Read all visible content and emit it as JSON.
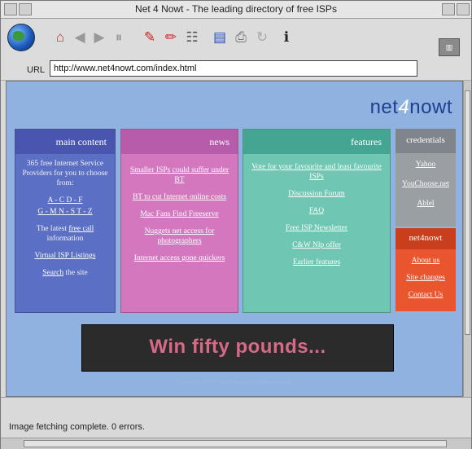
{
  "window": {
    "title": "Net 4 Nowt - The leading directory of free ISPs"
  },
  "toolbar": {
    "url_label": "URL",
    "url_value": "http://www.net4nowt.com/index.html",
    "icons": [
      "globe-icon",
      "home-icon",
      "back-icon",
      "forward-icon",
      "reload-icon",
      "edit-icon",
      "print-icon",
      "save-icon",
      "hotlist-icon",
      "stop-icon",
      "history-icon",
      "info-icon"
    ]
  },
  "site": {
    "logo_pre": "net",
    "logo_mid": "4",
    "logo_post": "nowt",
    "main": {
      "title": "main content",
      "intro": "365 free Internet Service Providers for you to choose from:",
      "alpha_1": "A - C  D - F",
      "alpha_2": "G - M  N - S  T - Z",
      "latest_pre": "The latest",
      "latest_link": "free call",
      "latest_post": "information",
      "virtual": "Virtual ISP Listings",
      "search_link": "Search",
      "search_post": "the site"
    },
    "news": {
      "title": "news",
      "items": [
        "Smaller ISPs could suffer under BT",
        "BT to cut Internet online costs",
        "Mac Fans Find Freeserve",
        "Nuggets net access for photographers",
        "Internet access gone quickers"
      ]
    },
    "features": {
      "title": "features",
      "items": [
        "Vote for your favourite and least favourite ISPs",
        "Discussion Forum",
        "FAQ",
        "Free ISP Newsletter",
        "C&W Nlp offer",
        "Earlier features"
      ]
    },
    "credentials": {
      "title": "credentials",
      "items": [
        "Yahoo",
        "YouChoose.net",
        "Ablel"
      ]
    },
    "net4nowt": {
      "title": "net4nowt",
      "items": [
        "About us",
        "Site changes",
        "Contact Us"
      ]
    },
    "banner": "Win fifty pounds...",
    "copyright": "Copyright ©1999 Net 4 Nowt. All rights reserved."
  },
  "status": {
    "text": "Image fetching complete. 0 errors."
  },
  "colors": {
    "page_bg": "#8fb2e0",
    "main": "#5b6fc4",
    "news": "#d378bf",
    "features": "#6fc6b2",
    "credentials": "#9a9fa4",
    "net4nowt": "#e8552e"
  }
}
